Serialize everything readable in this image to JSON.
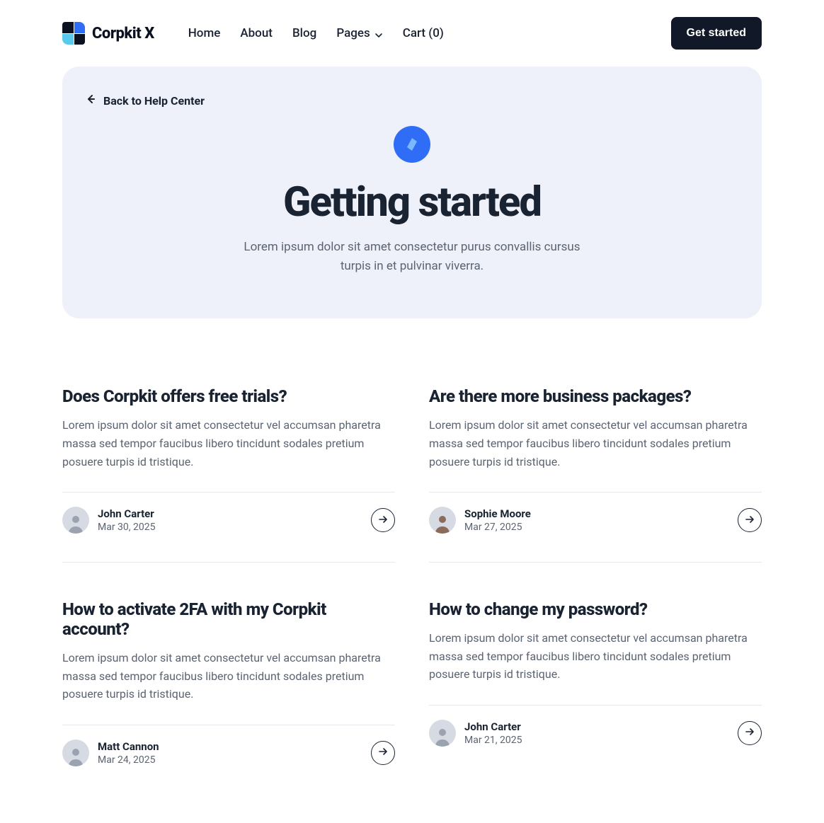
{
  "header": {
    "brand": "Corpkit X",
    "nav": {
      "home": "Home",
      "about": "About",
      "blog": "Blog",
      "pages": "Pages",
      "cart": "Cart (0)"
    },
    "cta": "Get started"
  },
  "hero": {
    "back": "Back to Help Center",
    "title": "Getting started",
    "subtitle": "Lorem ipsum dolor sit amet consectetur purus convallis cursus turpis in et pulvinar viverra."
  },
  "articles": [
    {
      "title": "Does Corpkit offers free trials?",
      "text": "Lorem ipsum dolor sit amet consectetur vel accumsan pharetra massa sed tempor faucibus libero tincidunt sodales pretium posuere turpis id tristique.",
      "author": "John Carter",
      "date": "Mar 30, 2025"
    },
    {
      "title": "Are there more business packages?",
      "text": "Lorem ipsum dolor sit amet consectetur vel accumsan pharetra massa sed tempor faucibus libero tincidunt sodales pretium posuere turpis id tristique.",
      "author": "Sophie Moore",
      "date": "Mar 27, 2025"
    },
    {
      "title": "How to activate 2FA with my Corpkit account?",
      "text": "Lorem ipsum dolor sit amet consectetur vel accumsan pharetra massa sed tempor faucibus libero tincidunt sodales pretium posuere turpis id tristique.",
      "author": "Matt Cannon",
      "date": "Mar 24, 2025"
    },
    {
      "title": "How to change my password?",
      "text": "Lorem ipsum dolor sit amet consectetur vel accumsan pharetra massa sed tempor faucibus libero tincidunt sodales pretium posuere turpis id tristique.",
      "author": "John Carter",
      "date": "Mar 21, 2025"
    }
  ]
}
